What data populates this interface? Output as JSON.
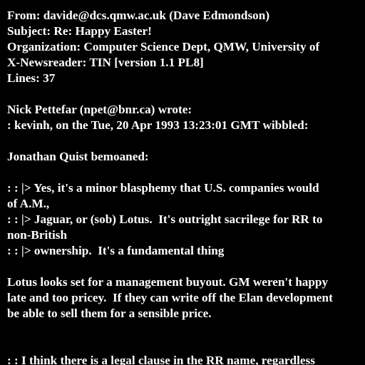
{
  "header": {
    "from": "From: davide@dcs.qmw.ac.uk (Dave Edmondson)",
    "subject": "Subject: Re: Happy Easter!",
    "organization": "Organization: Computer Science Dept, QMW, University of",
    "newsreader": "X-Newsreader: TIN [version 1.1 PL8]",
    "lines": "Lines: 37"
  },
  "body": {
    "attribution_1": "Nick Pettefar (npet@bnr.ca) wrote:",
    "attribution_2": ": kevinh, on the Tue, 20 Apr 1993 13:23:01 GMT wibbled:",
    "attribution_3": "Jonathan Quist bemoaned:",
    "quote": [
      ": : |> Yes, it's a minor blasphemy that U.S. companies would",
      "of A.M.,",
      ": : |> Jaguar, or (sob) Lotus.  It's outright sacrilege for RR to",
      "non-British",
      ": : |> ownership.  It's a fundamental thing"
    ],
    "reply": [
      "Lotus looks set for a management buyout. GM weren't happy",
      "late and too pricey.  If they can write off the Elan development",
      "be able to sell them for a sensible price."
    ],
    "trailing_quote": ": : I think there is a legal clause in the RR name, regardless"
  },
  "colors": {
    "background": "#000000",
    "text": "#ffffff"
  }
}
